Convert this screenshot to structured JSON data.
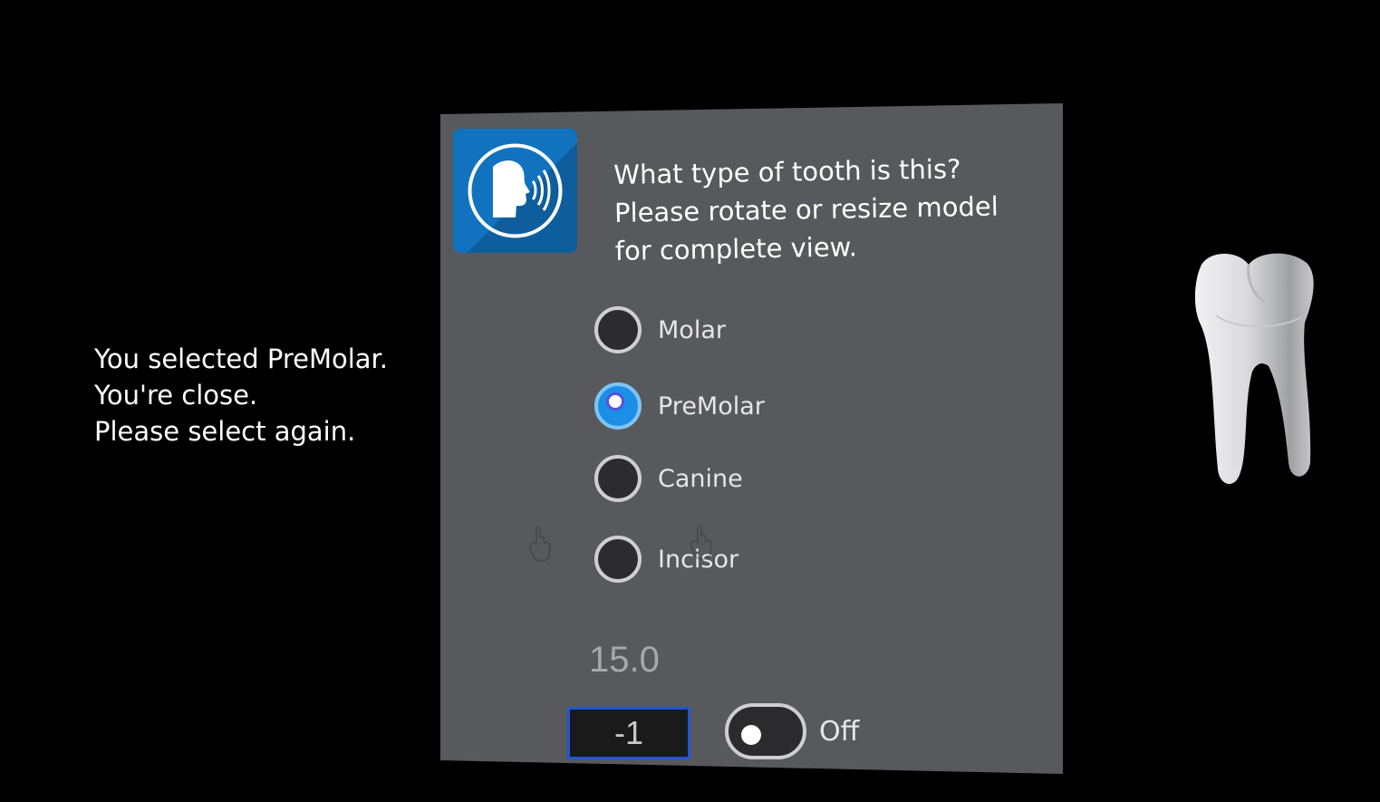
{
  "feedback": {
    "lines": [
      "You selected PreMolar.",
      "You're close.",
      "Please select again."
    ]
  },
  "quiz": {
    "speak_icon": "speaking-head-icon",
    "question_lines": [
      "What type of tooth is this?",
      "Please rotate or resize model",
      "for complete view."
    ],
    "options": [
      {
        "label": "Molar",
        "selected": false
      },
      {
        "label": "PreMolar",
        "selected": true
      },
      {
        "label": "Canine",
        "selected": false
      },
      {
        "label": "Incisor",
        "selected": false
      }
    ],
    "value_display": "15.0",
    "number_field_value": "-1",
    "toggle": {
      "label": "Off",
      "state": false
    }
  },
  "model": {
    "icon": "tooth-model"
  },
  "colors": {
    "background": "#000000",
    "panel": "#58595c",
    "speak_button": "#1173bf",
    "radio_selected": "#1b8fe6",
    "input_border": "#1e57d8"
  }
}
